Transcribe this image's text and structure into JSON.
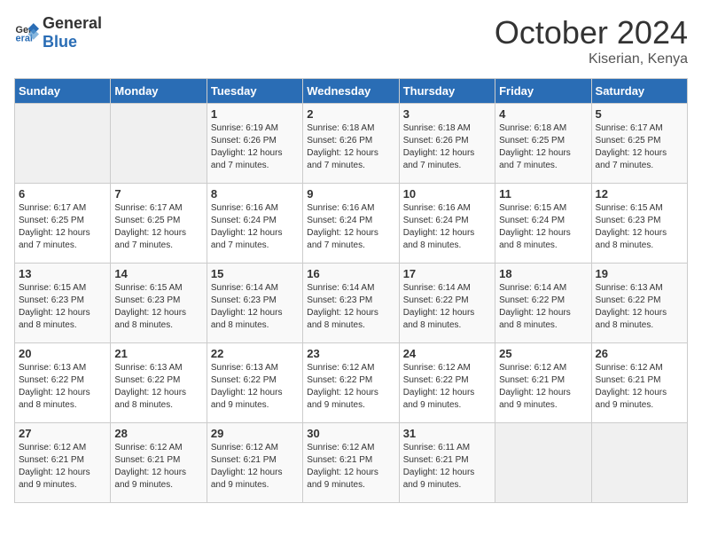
{
  "header": {
    "logo_general": "General",
    "logo_blue": "Blue",
    "month_title": "October 2024",
    "location": "Kiserian, Kenya"
  },
  "days_of_week": [
    "Sunday",
    "Monday",
    "Tuesday",
    "Wednesday",
    "Thursday",
    "Friday",
    "Saturday"
  ],
  "weeks": [
    [
      {
        "day": "",
        "sunrise": "",
        "sunset": "",
        "daylight": "",
        "empty": true
      },
      {
        "day": "",
        "sunrise": "",
        "sunset": "",
        "daylight": "",
        "empty": true
      },
      {
        "day": "1",
        "sunrise": "Sunrise: 6:19 AM",
        "sunset": "Sunset: 6:26 PM",
        "daylight": "Daylight: 12 hours and 7 minutes."
      },
      {
        "day": "2",
        "sunrise": "Sunrise: 6:18 AM",
        "sunset": "Sunset: 6:26 PM",
        "daylight": "Daylight: 12 hours and 7 minutes."
      },
      {
        "day": "3",
        "sunrise": "Sunrise: 6:18 AM",
        "sunset": "Sunset: 6:26 PM",
        "daylight": "Daylight: 12 hours and 7 minutes."
      },
      {
        "day": "4",
        "sunrise": "Sunrise: 6:18 AM",
        "sunset": "Sunset: 6:25 PM",
        "daylight": "Daylight: 12 hours and 7 minutes."
      },
      {
        "day": "5",
        "sunrise": "Sunrise: 6:17 AM",
        "sunset": "Sunset: 6:25 PM",
        "daylight": "Daylight: 12 hours and 7 minutes."
      }
    ],
    [
      {
        "day": "6",
        "sunrise": "Sunrise: 6:17 AM",
        "sunset": "Sunset: 6:25 PM",
        "daylight": "Daylight: 12 hours and 7 minutes."
      },
      {
        "day": "7",
        "sunrise": "Sunrise: 6:17 AM",
        "sunset": "Sunset: 6:25 PM",
        "daylight": "Daylight: 12 hours and 7 minutes."
      },
      {
        "day": "8",
        "sunrise": "Sunrise: 6:16 AM",
        "sunset": "Sunset: 6:24 PM",
        "daylight": "Daylight: 12 hours and 7 minutes."
      },
      {
        "day": "9",
        "sunrise": "Sunrise: 6:16 AM",
        "sunset": "Sunset: 6:24 PM",
        "daylight": "Daylight: 12 hours and 7 minutes."
      },
      {
        "day": "10",
        "sunrise": "Sunrise: 6:16 AM",
        "sunset": "Sunset: 6:24 PM",
        "daylight": "Daylight: 12 hours and 8 minutes."
      },
      {
        "day": "11",
        "sunrise": "Sunrise: 6:15 AM",
        "sunset": "Sunset: 6:24 PM",
        "daylight": "Daylight: 12 hours and 8 minutes."
      },
      {
        "day": "12",
        "sunrise": "Sunrise: 6:15 AM",
        "sunset": "Sunset: 6:23 PM",
        "daylight": "Daylight: 12 hours and 8 minutes."
      }
    ],
    [
      {
        "day": "13",
        "sunrise": "Sunrise: 6:15 AM",
        "sunset": "Sunset: 6:23 PM",
        "daylight": "Daylight: 12 hours and 8 minutes."
      },
      {
        "day": "14",
        "sunrise": "Sunrise: 6:15 AM",
        "sunset": "Sunset: 6:23 PM",
        "daylight": "Daylight: 12 hours and 8 minutes."
      },
      {
        "day": "15",
        "sunrise": "Sunrise: 6:14 AM",
        "sunset": "Sunset: 6:23 PM",
        "daylight": "Daylight: 12 hours and 8 minutes."
      },
      {
        "day": "16",
        "sunrise": "Sunrise: 6:14 AM",
        "sunset": "Sunset: 6:23 PM",
        "daylight": "Daylight: 12 hours and 8 minutes."
      },
      {
        "day": "17",
        "sunrise": "Sunrise: 6:14 AM",
        "sunset": "Sunset: 6:22 PM",
        "daylight": "Daylight: 12 hours and 8 minutes."
      },
      {
        "day": "18",
        "sunrise": "Sunrise: 6:14 AM",
        "sunset": "Sunset: 6:22 PM",
        "daylight": "Daylight: 12 hours and 8 minutes."
      },
      {
        "day": "19",
        "sunrise": "Sunrise: 6:13 AM",
        "sunset": "Sunset: 6:22 PM",
        "daylight": "Daylight: 12 hours and 8 minutes."
      }
    ],
    [
      {
        "day": "20",
        "sunrise": "Sunrise: 6:13 AM",
        "sunset": "Sunset: 6:22 PM",
        "daylight": "Daylight: 12 hours and 8 minutes."
      },
      {
        "day": "21",
        "sunrise": "Sunrise: 6:13 AM",
        "sunset": "Sunset: 6:22 PM",
        "daylight": "Daylight: 12 hours and 8 minutes."
      },
      {
        "day": "22",
        "sunrise": "Sunrise: 6:13 AM",
        "sunset": "Sunset: 6:22 PM",
        "daylight": "Daylight: 12 hours and 9 minutes."
      },
      {
        "day": "23",
        "sunrise": "Sunrise: 6:12 AM",
        "sunset": "Sunset: 6:22 PM",
        "daylight": "Daylight: 12 hours and 9 minutes."
      },
      {
        "day": "24",
        "sunrise": "Sunrise: 6:12 AM",
        "sunset": "Sunset: 6:22 PM",
        "daylight": "Daylight: 12 hours and 9 minutes."
      },
      {
        "day": "25",
        "sunrise": "Sunrise: 6:12 AM",
        "sunset": "Sunset: 6:21 PM",
        "daylight": "Daylight: 12 hours and 9 minutes."
      },
      {
        "day": "26",
        "sunrise": "Sunrise: 6:12 AM",
        "sunset": "Sunset: 6:21 PM",
        "daylight": "Daylight: 12 hours and 9 minutes."
      }
    ],
    [
      {
        "day": "27",
        "sunrise": "Sunrise: 6:12 AM",
        "sunset": "Sunset: 6:21 PM",
        "daylight": "Daylight: 12 hours and 9 minutes."
      },
      {
        "day": "28",
        "sunrise": "Sunrise: 6:12 AM",
        "sunset": "Sunset: 6:21 PM",
        "daylight": "Daylight: 12 hours and 9 minutes."
      },
      {
        "day": "29",
        "sunrise": "Sunrise: 6:12 AM",
        "sunset": "Sunset: 6:21 PM",
        "daylight": "Daylight: 12 hours and 9 minutes."
      },
      {
        "day": "30",
        "sunrise": "Sunrise: 6:12 AM",
        "sunset": "Sunset: 6:21 PM",
        "daylight": "Daylight: 12 hours and 9 minutes."
      },
      {
        "day": "31",
        "sunrise": "Sunrise: 6:11 AM",
        "sunset": "Sunset: 6:21 PM",
        "daylight": "Daylight: 12 hours and 9 minutes."
      },
      {
        "day": "",
        "sunrise": "",
        "sunset": "",
        "daylight": "",
        "empty": true
      },
      {
        "day": "",
        "sunrise": "",
        "sunset": "",
        "daylight": "",
        "empty": true
      }
    ]
  ]
}
